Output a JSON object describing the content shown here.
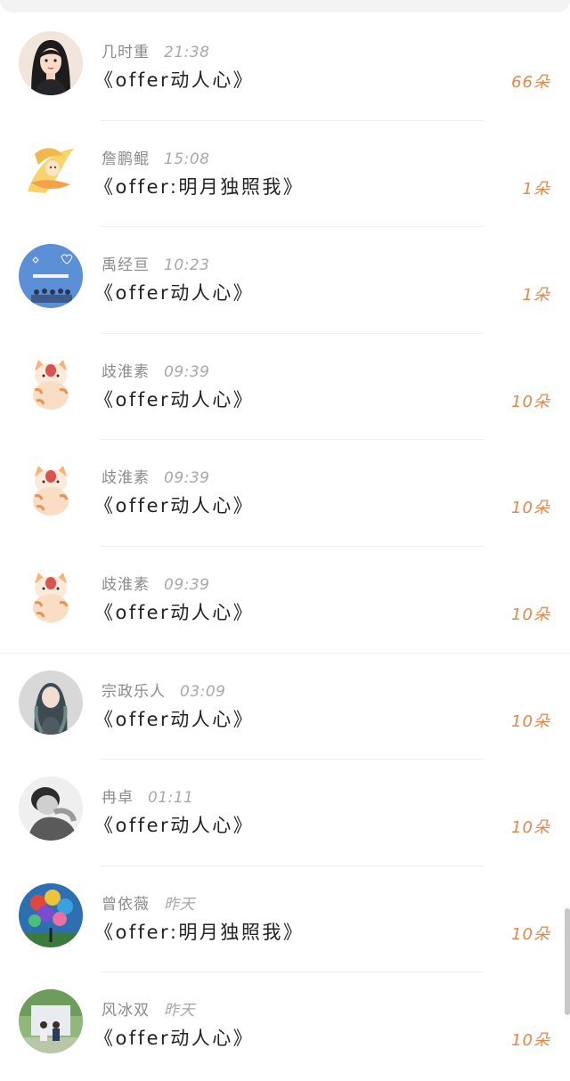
{
  "colors": {
    "count_accent": "#e0894c",
    "name_gray": "#8a8a8a",
    "title_dark": "#222222"
  },
  "gifts": [
    {
      "name": "几时重",
      "time": "21:38",
      "title": "《offer动人心》",
      "count": "66朵",
      "avatar": "portrait-girl-avatar"
    },
    {
      "name": "詹鹏鲲",
      "time": "15:08",
      "title": "《offer:明月独照我》",
      "count": "1朵",
      "avatar": "anime-character-avatar"
    },
    {
      "name": "禹经亘",
      "time": "10:23",
      "title": "《offer动人心》",
      "count": "1朵",
      "avatar": "teens-in-times-avatar"
    },
    {
      "name": "歧淮素",
      "time": "09:39",
      "title": "《offer动人心》",
      "count": "10朵",
      "avatar": "cartoon-cat-avatar"
    },
    {
      "name": "歧淮素",
      "time": "09:39",
      "title": "《offer动人心》",
      "count": "10朵",
      "avatar": "cartoon-cat-avatar"
    },
    {
      "name": "歧淮素",
      "time": "09:39",
      "title": "《offer动人心》",
      "count": "10朵",
      "avatar": "cartoon-cat-avatar"
    },
    {
      "name": "宗政乐人",
      "time": "03:09",
      "title": "《offer动人心》",
      "count": "10朵",
      "avatar": "long-hair-girl-avatar"
    },
    {
      "name": "冉卓",
      "time": "01:11",
      "title": "《offer动人心》",
      "count": "10朵",
      "avatar": "monochrome-child-avatar"
    },
    {
      "name": "曾依薇",
      "time": "昨天",
      "title": "《offer:明月独照我》",
      "count": "10朵",
      "avatar": "balloons-avatar"
    },
    {
      "name": "风冰双",
      "time": "昨天",
      "title": "《offer动人心》",
      "count": "10朵",
      "avatar": "outdoor-couple-avatar"
    }
  ]
}
